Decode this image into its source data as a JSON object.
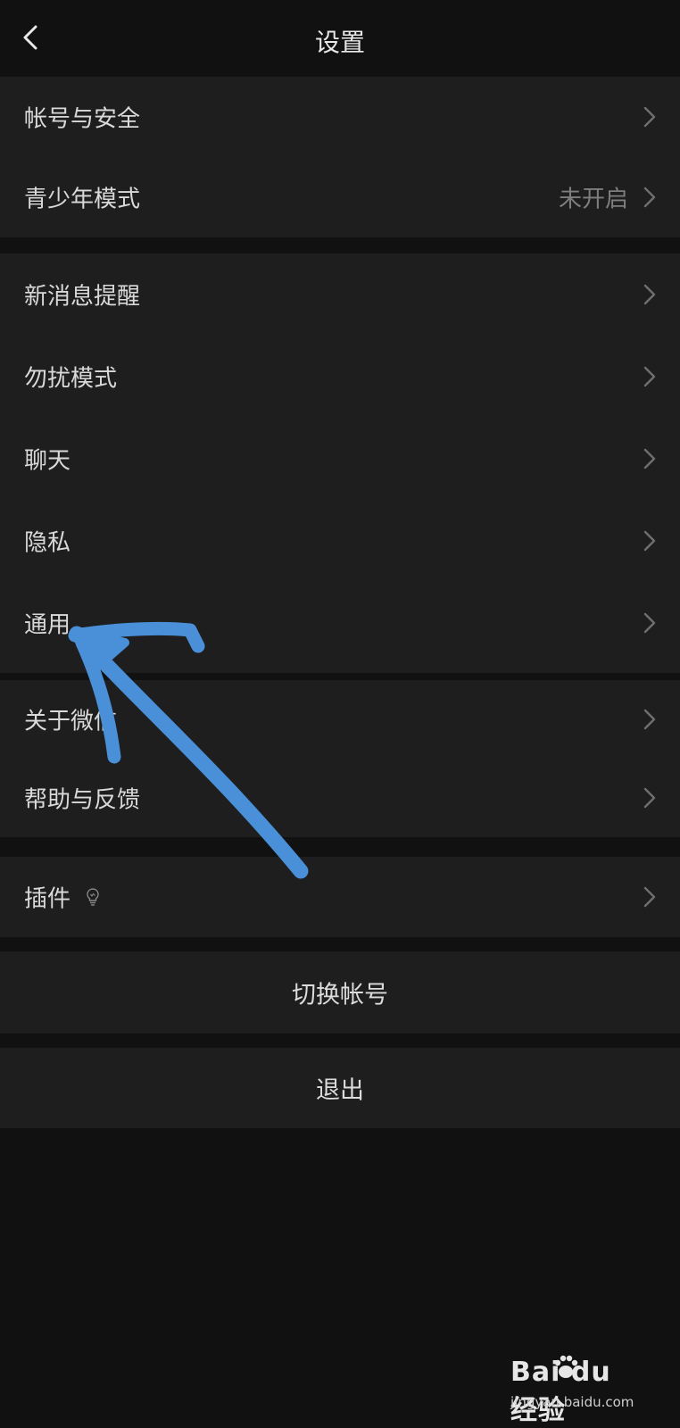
{
  "nav": {
    "title": "设置",
    "back_icon": "chevron-left-icon"
  },
  "groups": [
    {
      "items": [
        {
          "label": "帐号与安全",
          "value": ""
        },
        {
          "label": "青少年模式",
          "value": "未开启"
        }
      ]
    },
    {
      "items": [
        {
          "label": "新消息提醒"
        },
        {
          "label": "勿扰模式"
        },
        {
          "label": "聊天"
        },
        {
          "label": "隐私"
        },
        {
          "label": "通用"
        }
      ]
    },
    {
      "items": [
        {
          "label": "关于微信"
        },
        {
          "label": "帮助与反馈"
        }
      ]
    },
    {
      "items": [
        {
          "label": "插件",
          "badge_icon": "lightbulb-icon"
        }
      ]
    }
  ],
  "actions": {
    "switch_account": "切换帐号",
    "logout": "退出"
  },
  "annotation": {
    "type": "hand-drawn-arrow",
    "color": "#4a90d9",
    "points_to": "通用"
  },
  "watermark": {
    "logo_text": "Bai du 经验",
    "url": "jingyan.baidu.com"
  },
  "colors": {
    "background": "#111111",
    "cell": "#1e1e1e",
    "text": "#d9d9d9",
    "secondary_text": "#7e7e7e",
    "annotation": "#4a90d9"
  }
}
